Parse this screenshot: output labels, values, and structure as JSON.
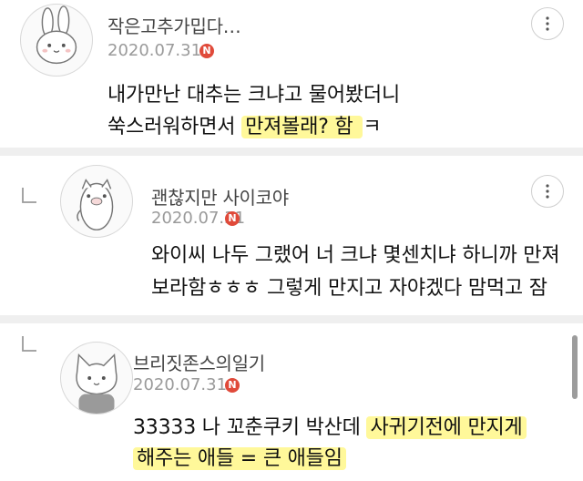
{
  "comments": [
    {
      "author": "작은고추가밉다…",
      "date": "2020.07.31",
      "badge": "N",
      "avatar_icon": "rabbit-avatar-icon",
      "line1": "내가만난 대추는 크냐고 물어봤더니",
      "line2_plain": "쑥스러워하면서 ",
      "line2_highlight": "만져볼래? 함 ",
      "line2_tail": "ㅋ"
    },
    {
      "author": "괜찮지만 사이코야",
      "date": "2020.07.31",
      "badge": "N",
      "avatar_icon": "pig-avatar-icon",
      "line1": "와이씨 나두 그랬어 너 크냐 몇센치냐 하니까 만져",
      "line2": "보라함ㅎㅎㅎ 그렇게 만지고 자야겠다 맘먹고 잠"
    },
    {
      "author": "브리짓존스의일기",
      "date": "2020.07.31",
      "badge": "N",
      "avatar_icon": "cat-avatar-icon",
      "line1_plain": "33333 나 꼬춘쿠키 박산데 ",
      "line1_highlight": "사귀기전에 만지게",
      "line2_highlight": "해주는 애들 = 큰 애들임"
    }
  ],
  "colors": {
    "badge": "#e04a3a",
    "highlight": "#fff578",
    "separator": "#efefef",
    "date": "#9a9a9a"
  },
  "icons": {
    "more": "more-vertical-icon",
    "reply": "reply-arrow-icon"
  }
}
